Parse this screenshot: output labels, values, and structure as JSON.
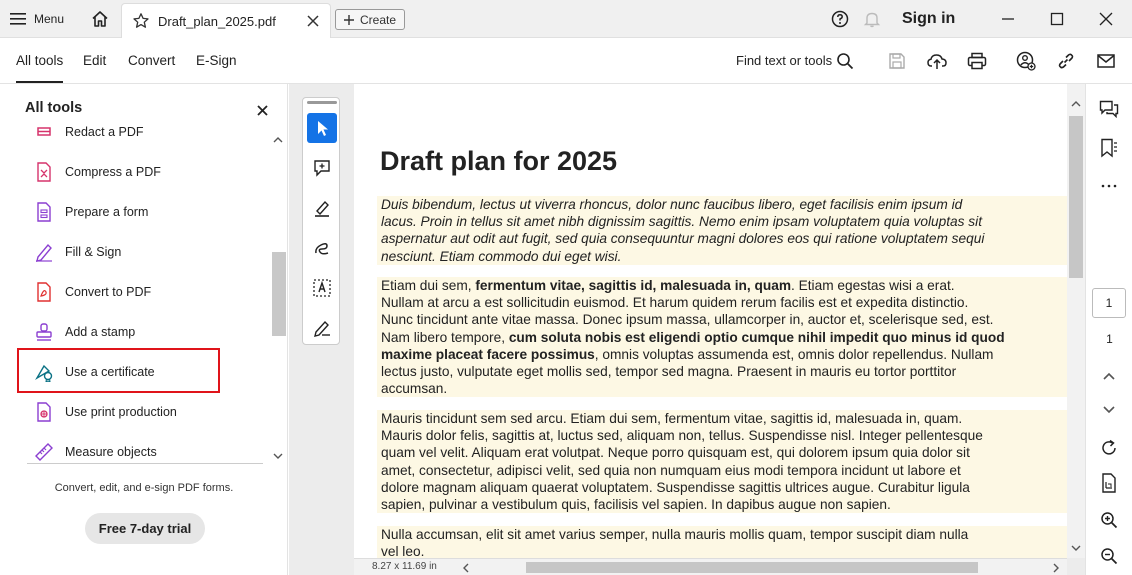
{
  "titlebar": {
    "menu_label": "Menu",
    "tab_title": "Draft_plan_2025.pdf",
    "create_label": "Create",
    "signin_label": "Sign in"
  },
  "toolbar": {
    "tabs": [
      "All tools",
      "Edit",
      "Convert",
      "E-Sign"
    ],
    "active_tab": "All tools",
    "find_label": "Find text or tools"
  },
  "left_panel": {
    "title": "All tools",
    "items": [
      {
        "label": "Redact a PDF",
        "icon": "redact-icon"
      },
      {
        "label": "Compress a PDF",
        "icon": "compress-icon"
      },
      {
        "label": "Prepare a form",
        "icon": "form-icon"
      },
      {
        "label": "Fill & Sign",
        "icon": "fill-sign-icon"
      },
      {
        "label": "Convert to PDF",
        "icon": "convert-icon"
      },
      {
        "label": "Add a stamp",
        "icon": "stamp-icon"
      },
      {
        "label": "Use a certificate",
        "icon": "certificate-icon"
      },
      {
        "label": "Use print production",
        "icon": "print-production-icon"
      },
      {
        "label": "Measure objects",
        "icon": "measure-icon"
      }
    ],
    "highlighted_item": "Use a certificate",
    "promo_text": "Convert, edit, and e-sign PDF forms.",
    "trial_button": "Free 7-day trial"
  },
  "document": {
    "title": "Draft plan for 2025",
    "paragraphs": [
      "Duis bibendum, lectus ut viverra rhoncus, dolor nunc faucibus libero, eget facilisis enim ipsum id\nlacus. Proin in tellus sit amet nibh dignissim sagittis. Nemo enim ipsam voluptatem quia voluptas sit\naspernatur aut odit aut fugit, sed quia consequuntur magni dolores eos qui ratione voluptatem sequi\nnesciunt. Etiam commodo dui eget wisi.",
      "Mauris tincidunt sem sed arcu. Etiam dui sem, fermentum vitae, sagittis id, malesuada in, quam.\nMauris dolor felis, sagittis at, luctus sed, aliquam non, tellus. Suspendisse nisl. Integer pellentesque\nquam vel velit. Aliquam erat volutpat. Neque porro quisquam est, qui dolorem ipsum quia dolor sit\namet, consectetur, adipisci velit, sed quia non numquam eius modi tempora incidunt ut labore et\ndolore magnam aliquam quaerat voluptatem. Suspendisse sagittis ultrices augue. Curabitur ligula\nsapien, pulvinar a vestibulum quis, facilisis vel sapien. In dapibus augue non sapien.",
      "Nulla accumsan, elit sit amet varius semper, nulla mauris mollis quam, tempor suscipit diam nulla\nvel leo."
    ],
    "para2": {
      "lead": "Etiam dui sem, ",
      "bold1": "fermentum vitae, sagittis id, malesuada in, quam",
      "mid1": ". Etiam egestas wisi a erat.\nNullam at arcu a est sollicitudin euismod. Et harum quidem rerum facilis est et expedita distinctio.\nNunc tincidunt ante vitae massa. Donec ipsum massa, ullamcorper in, auctor et, scelerisque sed, est.\nNam libero tempore, ",
      "bold2": "cum soluta nobis est eligendi optio cumque nihil impedit quo minus id quod\nmaxime placeat facere possimus",
      "tail": ", omnis voluptas assumenda est, omnis dolor repellendus. Nullam\nlectus justo, vulputate eget mollis sed, tempor sed magna. Praesent in mauris eu tortor porttitor\naccumsan."
    },
    "page_size": "8.27 x 11.69 in"
  },
  "right_rail": {
    "current_page": "1",
    "total_pages": "1"
  },
  "colors": {
    "accent": "#1473e6",
    "highlight_border": "#e0141a",
    "text_highlight": "#fdf8e4"
  }
}
